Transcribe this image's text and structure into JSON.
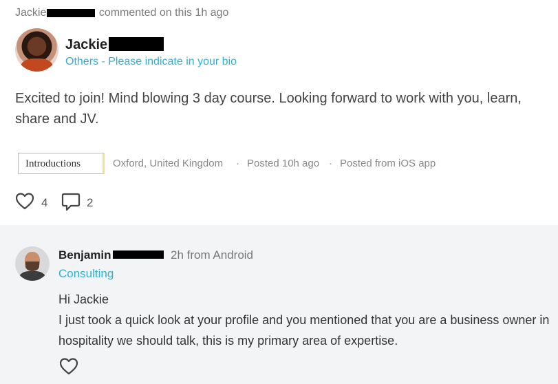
{
  "activity": {
    "actor_first": "Jackie",
    "action": "commented on this 1h ago"
  },
  "post": {
    "author_first": "Jackie",
    "author_role": "Others - Please indicate in your bio",
    "body": "Excited to join! Mind blowing 3 day course. Looking forward to work with you, learn, share and JV.",
    "topic": "Introductions",
    "location": "Oxford, United Kingdom",
    "separator": "·",
    "posted": "Posted 10h ago",
    "source": "Posted from iOS app",
    "likes": "4",
    "comments": "2"
  },
  "comment": {
    "author_first": "Benjamin",
    "meta": "2h from Android",
    "role": "Consulting",
    "line1": "Hi Jackie",
    "line2": "I just took a quick look at your profile and you mentioned that you are a business owner in hospitality we should talk, this is my primary area of expertise."
  },
  "colors": {
    "accent": "#31b0d5",
    "tag_highlight": "#f2e08a",
    "comment_bg": "#f3f4f6"
  },
  "icons": [
    "heart-icon",
    "comment-bubble-icon"
  ]
}
